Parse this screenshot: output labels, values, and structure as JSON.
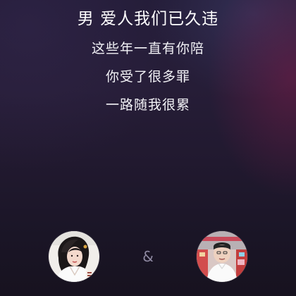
{
  "lyrics": {
    "current_line": "男 爱人我们已久违",
    "lines": [
      "这些年一直有你陪",
      "你受了很多罪",
      "一路随我很累"
    ]
  },
  "duet": {
    "separator": "&"
  },
  "colors": {
    "background_top": "#231c37",
    "background_bottom": "#17121f",
    "lyric_text": "#f2f2f6",
    "separator": "#8d88a0",
    "accent_glow": "#781c48"
  }
}
